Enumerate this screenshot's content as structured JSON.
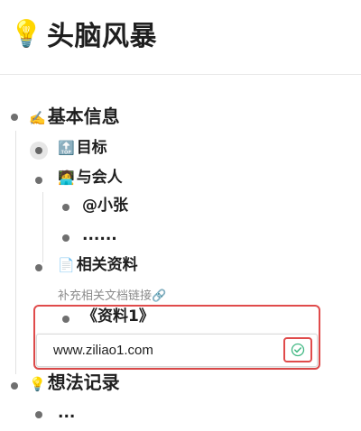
{
  "page": {
    "title": "头脑风暴",
    "title_icon": "lightbulb-icon"
  },
  "outline": {
    "root_1": {
      "icon": "writing-hand-icon",
      "label": "基本信息"
    },
    "goal": {
      "icon": "top-arrow-icon",
      "label": "目标"
    },
    "participants": {
      "icon": "person-at-laptop-icon",
      "label": "与会人"
    },
    "participant_1": {
      "label": "@小张"
    },
    "participant_more": {
      "label": "......"
    },
    "materials": {
      "icon": "document-icon",
      "label": "相关资料"
    },
    "materials_note": "补充相关文档链接🔗",
    "material_1": {
      "label": "《资料1》"
    },
    "edit_link": {
      "value": "www.ziliao1.com"
    },
    "root_2": {
      "icon": "lightbulb-icon",
      "label": "想法记录"
    },
    "idea_more": {
      "label": "..."
    }
  },
  "colors": {
    "highlight_red": "#e04b4b",
    "confirm_green": "#41b883",
    "bullet_gray": "#6f6f6f",
    "note_gray": "#8b8b8b"
  }
}
